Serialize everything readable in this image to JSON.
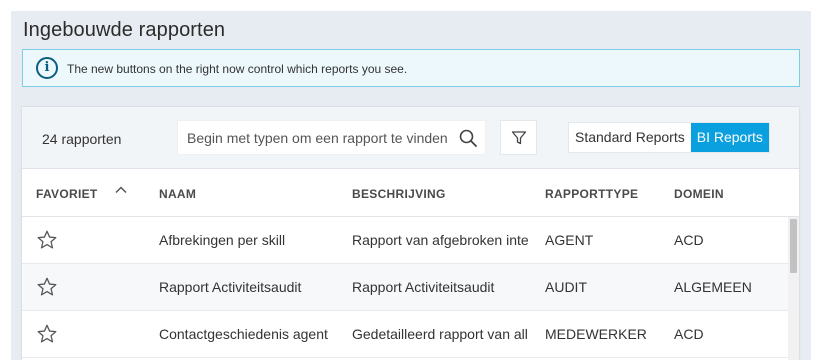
{
  "page": {
    "title": "Ingebouwde rapporten"
  },
  "info_banner": {
    "icon": "info-icon",
    "text": "The new buttons on the right now control which reports you see."
  },
  "toolbar": {
    "report_count": "24 rapporten",
    "search_placeholder": "Begin met typen om een rapport te vinden",
    "search_icon": "search-icon",
    "filter_icon": "filter-icon",
    "toggle": {
      "standard_label": "Standard Reports",
      "bi_label": "BI Reports",
      "active": "BI Reports"
    }
  },
  "table": {
    "columns": {
      "favoriet": "FAVORIET",
      "naam": "NAAM",
      "beschrijving": "BESCHRIJVING",
      "rapporttype": "RAPPORTTYPE",
      "domein": "DOMEIN"
    },
    "sort": {
      "column": "FAVORIET",
      "direction": "ascending"
    },
    "rows": [
      {
        "naam": "Afbrekingen per skill",
        "beschrijving": "Rapport van afgebroken inte",
        "rapporttype": "AGENT",
        "domein": "ACD"
      },
      {
        "naam": "Rapport Activiteitsaudit",
        "beschrijving": "Rapport Activiteitsaudit",
        "rapporttype": "AUDIT",
        "domein": "ALGEMEEN"
      },
      {
        "naam": "Contactgeschiedenis agent",
        "beschrijving": "Gedetailleerd rapport van all",
        "rapporttype": "MEDEWERKER",
        "domein": "ACD"
      }
    ]
  },
  "colors": {
    "accent": "#0aa0e0",
    "info_border": "#7ccde8",
    "info_background": "#edf8fc",
    "page_background": "#e6ecf1"
  }
}
